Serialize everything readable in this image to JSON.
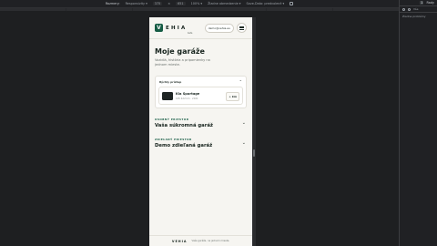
{
  "devtools": {
    "dimensions_label": "Rozmery:",
    "device": "Responsivity",
    "width": "375",
    "times": "×",
    "height": "651",
    "zoom": "100%",
    "throttle": "Žiadne obmedzenie",
    "save_data": "Save-Data: predvolené",
    "panel": {
      "issues_count": "1",
      "top_menu": "Rady",
      "filter": "Vše",
      "msg": "Žiadne problémy"
    }
  },
  "app": {
    "logo_letter": "V",
    "logo_word": "EHIA",
    "logo_sub": "beta",
    "email": "demo@vehia.eu",
    "title": "Moje garáže",
    "subtitle": "Vozidlá, história a pripomienky na jednom mieste.",
    "quick": {
      "label": "Rýchly prístup",
      "car": {
        "name": "Kia Sportage",
        "meta": "145 422 km · 2021",
        "action": "+ km"
      }
    },
    "sections": [
      {
        "caption": "OSOBNÝ PRIESTOR",
        "heading": "Vaša súkromná garáž"
      },
      {
        "caption": "ZDIEĽANÝ PRIESTOR",
        "heading": "Demo zdieľaná garáž"
      }
    ],
    "footer": {
      "word": "VEHIA",
      "tagline": "Vaše garáže, na jednom mieste."
    }
  }
}
